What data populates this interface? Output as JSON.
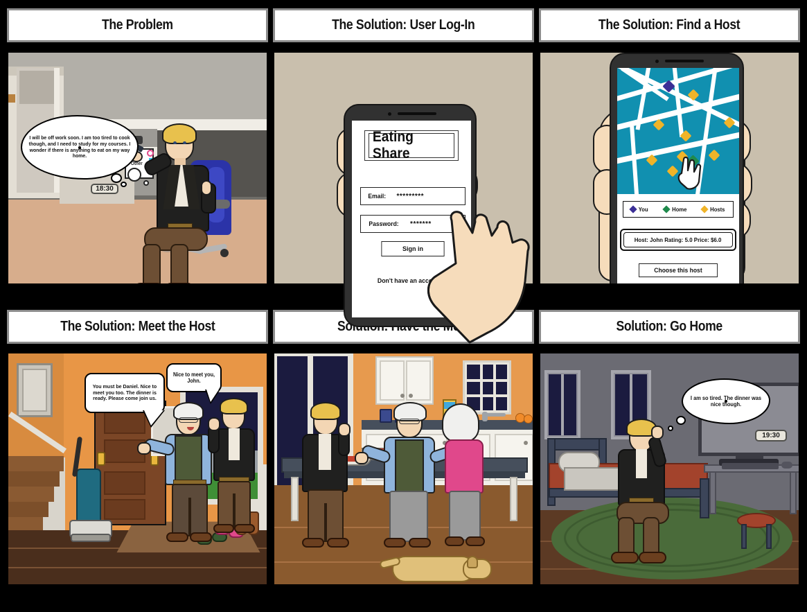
{
  "board": {
    "background_color": "#000000",
    "rows": 2,
    "columns": 3
  },
  "panels": [
    {
      "id": "panel-problem",
      "title": "The Problem",
      "scene": "office-cubicle",
      "thought_bubble": "I will be off work soon. I am too tired to cook though, and I need to study for my courses. I wonder if there is anything to eat on my way home.",
      "clock": "18:30",
      "whiteboard_label": "Other",
      "colors": {
        "floor": "#d7ad8c",
        "cubicle": "#cfc9c0",
        "wall": "#8b8984",
        "chair": "#2b33a8"
      }
    },
    {
      "id": "panel-login",
      "title": "The Solution: User Log-In",
      "scene": "phone-login",
      "app": {
        "logo": "Eating Share",
        "email_label": "Email:",
        "email_value": "*********",
        "password_label": "Password:",
        "password_value": "*******",
        "signin_label": "Sign in",
        "signup_link": "Don't have an account?"
      },
      "colors": {
        "background": "#c9bfad",
        "phone_body": "#313131",
        "skin": "#f6dcbb"
      }
    },
    {
      "id": "panel-find-host",
      "title": "The Solution: Find a Host",
      "scene": "phone-map",
      "map": {
        "legend": [
          {
            "label": "You",
            "color": "#3b2f96"
          },
          {
            "label": "Home",
            "color": "#1f8a4c"
          },
          {
            "label": "Hosts",
            "color": "#f0b429"
          }
        ],
        "info_card": "Host: John Rating: 5.0 Price: $6.0",
        "choose_button": "Choose  this  host",
        "map_background": "#1190b0",
        "road_color": "#ffffff"
      },
      "colors": {
        "background": "#c9bfad",
        "phone_body": "#313131"
      }
    },
    {
      "id": "panel-meet-host",
      "title": "The Solution: Meet the Host",
      "scene": "entrance-hall",
      "speech_host": "You must be Daniel. Nice to meet you too. The dinner is ready. Please come join us.",
      "speech_guest": "Nice to meet you, John.",
      "colors": {
        "wall": "#e89646",
        "floor": "#4a2e1c",
        "door": "#7b4626",
        "night_sky": "#1b1b3f",
        "lawn": "#3f8f36"
      }
    },
    {
      "id": "panel-have-meal",
      "title": "Solution: Have the Meal",
      "scene": "kitchen-dinner",
      "colors": {
        "wall": "#e79a4e",
        "cabinet": "#f1efe8",
        "counter": "#464f5c",
        "floor": "#8a5a2e",
        "window_night": "#1b1b3f"
      }
    },
    {
      "id": "panel-go-home",
      "title": "Solution: Go Home",
      "scene": "bedroom",
      "thought_bubble": "I am so tired. The dinner was nice though.",
      "clock": "19:30",
      "colors": {
        "wall": "#6b6b73",
        "rug": "#4a6b3a",
        "floor": "#5c3a24",
        "bed": "#a3432c",
        "tv": "#8b8b93"
      }
    }
  ]
}
